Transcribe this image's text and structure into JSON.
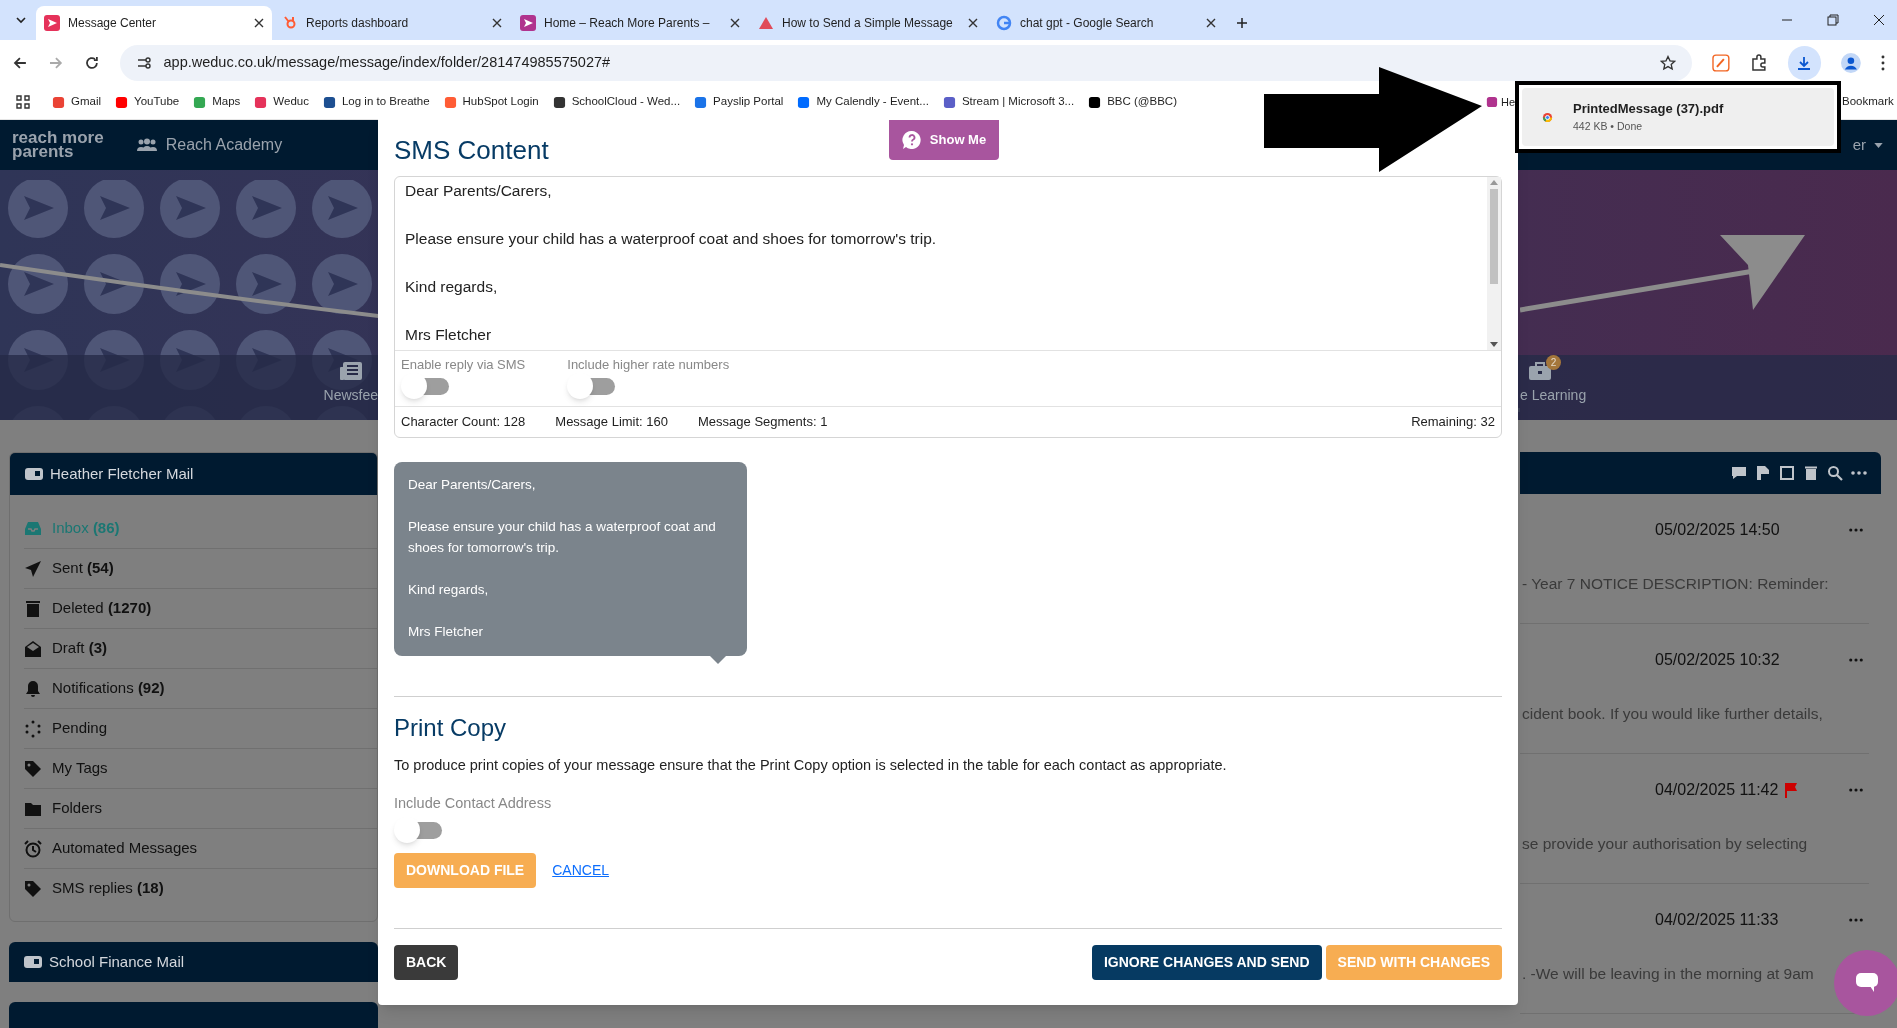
{
  "browser": {
    "tabs": [
      {
        "title": "Message Center",
        "selected": true
      },
      {
        "title": "Reports dashboard",
        "selected": false
      },
      {
        "title": "Home – Reach More Parents –",
        "selected": false
      },
      {
        "title": "How to Send a Simple Message",
        "selected": false
      },
      {
        "title": "chat gpt - Google Search",
        "selected": false
      }
    ],
    "url": "app.weduc.co.uk/message/message/index/folder/281474985575027#",
    "bookmarks": [
      "Gmail",
      "YouTube",
      "Maps",
      "Weduc",
      "Log in to Breathe",
      "HubSpot Login",
      "SchoolCloud - Wed...",
      "Payslip Portal",
      "My Calendly - Event...",
      "Stream | Microsoft 3...",
      "BBC (@BBC)"
    ],
    "bookmark_cut": "He",
    "bookmarks_end": "Bookmark"
  },
  "downloads_popup": {
    "file": "PrintedMessage (37).pdf",
    "detail": "442 KB • Done"
  },
  "page": {
    "logo_lines": [
      "reach more",
      "parents"
    ],
    "school": "Reach Academy",
    "user_menu": "er",
    "nav": [
      {
        "label": "Newsfee"
      },
      {
        "label": "e Learning",
        "badge": "2"
      }
    ]
  },
  "mailbox": {
    "title": "Heather Fletcher Mail",
    "folders": [
      {
        "label": "Inbox",
        "count": "(86)",
        "selected": true
      },
      {
        "label": "Sent",
        "count": "(54)",
        "selected": false
      },
      {
        "label": "Deleted",
        "count": "(1270)",
        "selected": false
      },
      {
        "label": "Draft",
        "count": "(3)",
        "selected": false
      },
      {
        "label": "Notifications",
        "count": "(92)",
        "selected": false
      },
      {
        "label": "Pending",
        "selected": false
      },
      {
        "label": "My Tags",
        "selected": false
      },
      {
        "label": "Folders",
        "selected": false
      },
      {
        "label": "Automated Messages",
        "selected": false
      },
      {
        "label": "SMS replies",
        "count": "(18)",
        "selected": false
      }
    ]
  },
  "second_mailbox": {
    "title": "School Finance Mail"
  },
  "messages": [
    {
      "date": "05/02/2025 14:50",
      "snippet": "- Year 7 NOTICE DESCRIPTION: Reminder:",
      "flagged": false
    },
    {
      "date": "05/02/2025 10:32",
      "snippet": "cident book. If you would like further details,",
      "flagged": false
    },
    {
      "date": "04/02/2025 11:42",
      "snippet": "se provide your authorisation by selecting",
      "flagged": true
    },
    {
      "date": "04/02/2025 11:33",
      "snippet": ". -We will be leaving in the morning at 9am",
      "flagged": false
    }
  ],
  "modal": {
    "title": "SMS Content",
    "help_button": "Show Me",
    "message_lines": [
      "Dear Parents/Carers,",
      "Please ensure your child has a waterproof coat and shoes for tomorrow's trip.",
      "Kind regards,",
      "Mrs Fletcher"
    ],
    "toggles": [
      {
        "label": "Enable reply via SMS",
        "on": false
      },
      {
        "label": "Include higher rate numbers",
        "on": false
      }
    ],
    "stats": [
      "Character Count: 128",
      "Message Limit: 160",
      "Message Segments: 1"
    ],
    "remaining": "Remaining: 32",
    "preview_lines": [
      "Dear Parents/Carers,",
      "Please ensure your child has a waterproof coat and shoes for tomorrow's trip.",
      "Kind regards,",
      "Mrs Fletcher"
    ],
    "print_copy": {
      "title": "Print Copy",
      "description": "To produce print copies of your message ensure that the Print Copy option is selected in the table for each contact as appropriate.",
      "toggle": {
        "label": "Include Contact Address",
        "on": false
      },
      "download_button": "DOWNLOAD FILE",
      "cancel_link": "CANCEL"
    },
    "footer": {
      "back": "BACK",
      "ignore": "IGNORE CHANGES AND SEND",
      "send": "SEND WITH CHANGES"
    }
  }
}
